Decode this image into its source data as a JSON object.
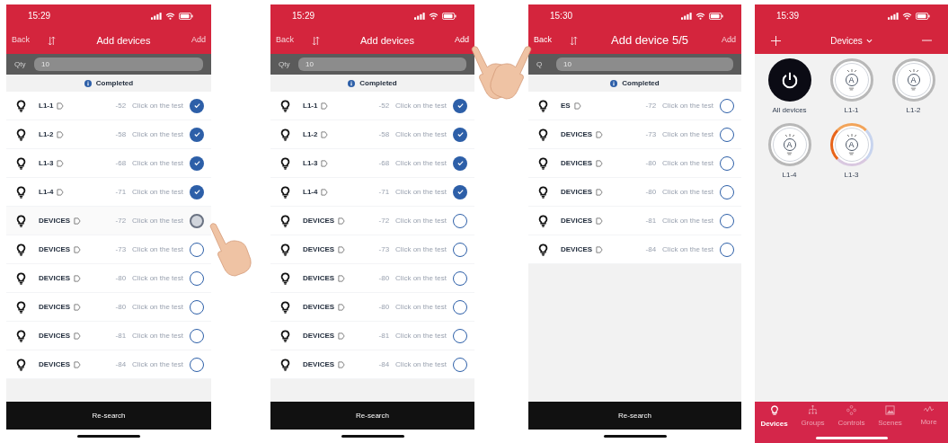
{
  "screens": [
    {
      "kind": "add",
      "add_touched": false,
      "back_touched": false,
      "time": "15:29",
      "back": "Back",
      "title": "Add devices",
      "add": "Add",
      "qty_label": "Qty",
      "qty_value": "10",
      "status": "Completed",
      "button": "Re-search",
      "rows": [
        {
          "name": "L1-1",
          "rssi": "-52",
          "hint": "Click on the test",
          "checked": true,
          "pressed": false
        },
        {
          "name": "L1-2",
          "rssi": "-58",
          "hint": "Click on the test",
          "checked": true,
          "pressed": false
        },
        {
          "name": "L1-3",
          "rssi": "-68",
          "hint": "Click on the test",
          "checked": true,
          "pressed": false
        },
        {
          "name": "L1-4",
          "rssi": "-71",
          "hint": "Click on the test",
          "checked": true,
          "pressed": false
        },
        {
          "name": "DEVICES",
          "rssi": "-72",
          "hint": "Click on the test",
          "checked": false,
          "pressed": true
        },
        {
          "name": "DEVICES",
          "rssi": "-73",
          "hint": "Click on the test",
          "checked": false,
          "pressed": false
        },
        {
          "name": "DEVICES",
          "rssi": "-80",
          "hint": "Click on the test",
          "checked": false,
          "pressed": false
        },
        {
          "name": "DEVICES",
          "rssi": "-80",
          "hint": "Click on the test",
          "checked": false,
          "pressed": false
        },
        {
          "name": "DEVICES",
          "rssi": "-81",
          "hint": "Click on the test",
          "checked": false,
          "pressed": false
        },
        {
          "name": "DEVICES",
          "rssi": "-84",
          "hint": "Click on the test",
          "checked": false,
          "pressed": false
        }
      ]
    },
    {
      "kind": "add",
      "add_touched": true,
      "back_touched": false,
      "time": "15:29",
      "back": "Back",
      "title": "Add devices",
      "add": "Add",
      "qty_label": "Qty",
      "qty_value": "10",
      "status": "Completed",
      "button": "Re-search",
      "rows": [
        {
          "name": "L1-1",
          "rssi": "-52",
          "hint": "Click on the test",
          "checked": true,
          "pressed": false
        },
        {
          "name": "L1-2",
          "rssi": "-58",
          "hint": "Click on the test",
          "checked": true,
          "pressed": false
        },
        {
          "name": "L1-3",
          "rssi": "-68",
          "hint": "Click on the test",
          "checked": true,
          "pressed": false
        },
        {
          "name": "L1-4",
          "rssi": "-71",
          "hint": "Click on the test",
          "checked": true,
          "pressed": false
        },
        {
          "name": "DEVICES",
          "rssi": "-72",
          "hint": "Click on the test",
          "checked": false,
          "pressed": false
        },
        {
          "name": "DEVICES",
          "rssi": "-73",
          "hint": "Click on the test",
          "checked": false,
          "pressed": false
        },
        {
          "name": "DEVICES",
          "rssi": "-80",
          "hint": "Click on the test",
          "checked": false,
          "pressed": false
        },
        {
          "name": "DEVICES",
          "rssi": "-80",
          "hint": "Click on the test",
          "checked": false,
          "pressed": false
        },
        {
          "name": "DEVICES",
          "rssi": "-81",
          "hint": "Click on the test",
          "checked": false,
          "pressed": false
        },
        {
          "name": "DEVICES",
          "rssi": "-84",
          "hint": "Click on the test",
          "checked": false,
          "pressed": false
        }
      ]
    },
    {
      "kind": "add",
      "add_touched": false,
      "back_touched": true,
      "time": "15:30",
      "back": "Back",
      "title": "Add device 5/5",
      "add": "Add",
      "qty_label": "Q",
      "qty_value": "10",
      "status": "Completed",
      "button": "Re-search",
      "rows": [
        {
          "name": "ES",
          "rssi": "-72",
          "hint": "Click on the test",
          "checked": false,
          "pressed": false
        },
        {
          "name": "DEVICES",
          "rssi": "-73",
          "hint": "Click on the test",
          "checked": false,
          "pressed": false
        },
        {
          "name": "DEVICES",
          "rssi": "-80",
          "hint": "Click on the test",
          "checked": false,
          "pressed": false
        },
        {
          "name": "DEVICES",
          "rssi": "-80",
          "hint": "Click on the test",
          "checked": false,
          "pressed": false
        },
        {
          "name": "DEVICES",
          "rssi": "-81",
          "hint": "Click on the test",
          "checked": false,
          "pressed": false
        },
        {
          "name": "DEVICES",
          "rssi": "-84",
          "hint": "Click on the test",
          "checked": false,
          "pressed": false
        }
      ]
    },
    {
      "kind": "home",
      "time": "15:39",
      "title": "Devices",
      "devices": [
        {
          "kind": "all",
          "label": "All devices"
        },
        {
          "kind": "light",
          "mark": "A",
          "label": "L1-1",
          "on": false
        },
        {
          "kind": "light",
          "mark": "A",
          "label": "L1-2",
          "on": false
        },
        {
          "kind": "light",
          "mark": "A",
          "label": "L1-4",
          "on": false
        },
        {
          "kind": "light",
          "mark": "A",
          "label": "L1-3",
          "on": true
        }
      ],
      "tabs": [
        {
          "kind": "devices",
          "label": "Devices",
          "selected": true
        },
        {
          "kind": "groups",
          "label": "Groups",
          "selected": false
        },
        {
          "kind": "controls",
          "label": "Controls",
          "selected": false
        },
        {
          "kind": "scenes",
          "label": "Scenes",
          "selected": false
        },
        {
          "kind": "more",
          "label": "More",
          "selected": false
        }
      ]
    }
  ]
}
